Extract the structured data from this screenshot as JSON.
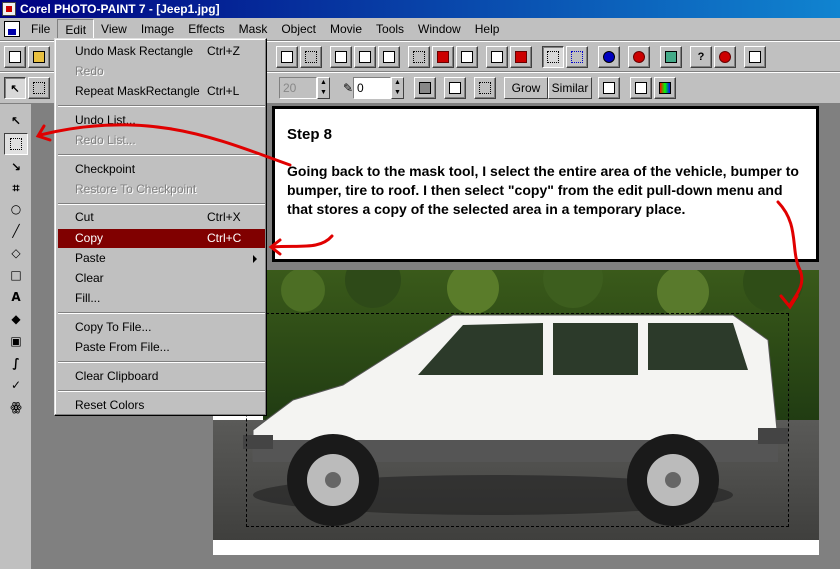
{
  "window": {
    "title": "Corel PHOTO-PAINT 7 - [Jeep1.jpg]"
  },
  "menubar": {
    "items": [
      "File",
      "Edit",
      "View",
      "Image",
      "Effects",
      "Mask",
      "Object",
      "Movie",
      "Tools",
      "Window",
      "Help"
    ],
    "active": "Edit"
  },
  "property_bar": {
    "size_value": "20",
    "transparency_value": "0",
    "grow_label": "Grow",
    "similar_label": "Similar"
  },
  "edit_menu": {
    "items": [
      {
        "label": "Undo Mask Rectangle",
        "shortcut": "Ctrl+Z",
        "disabled": false
      },
      {
        "label": "Redo",
        "shortcut": "",
        "disabled": true
      },
      {
        "label": "Repeat MaskRectangle",
        "shortcut": "Ctrl+L",
        "disabled": false
      },
      {
        "label": "Undo List...",
        "shortcut": "",
        "disabled": false
      },
      {
        "label": "Redo List...",
        "shortcut": "",
        "disabled": true
      },
      {
        "label": "Checkpoint",
        "shortcut": "",
        "disabled": false
      },
      {
        "label": "Restore To Checkpoint",
        "shortcut": "",
        "disabled": true
      },
      {
        "label": "Cut",
        "shortcut": "Ctrl+X",
        "disabled": false
      },
      {
        "label": "Copy",
        "shortcut": "Ctrl+C",
        "disabled": false,
        "highlighted": true
      },
      {
        "label": "Paste",
        "shortcut": "",
        "disabled": false,
        "submenu": true
      },
      {
        "label": "Clear",
        "shortcut": "",
        "disabled": false
      },
      {
        "label": "Fill...",
        "shortcut": "",
        "disabled": false
      },
      {
        "label": "Copy To File...",
        "shortcut": "",
        "disabled": false
      },
      {
        "label": "Paste From File...",
        "shortcut": "",
        "disabled": false
      },
      {
        "label": "Clear Clipboard",
        "shortcut": "",
        "disabled": false
      },
      {
        "label": "Reset Colors",
        "shortcut": "",
        "disabled": false
      }
    ]
  },
  "instruction": {
    "step": "Step 8",
    "text": "Going back to the mask tool, I select the entire area of the vehicle, bumper to bumper, tire to roof. I then select \"copy\" from the edit pull-down menu and that stores a copy of the selected area in a temporary place."
  },
  "colors": {
    "title_bar": "#000080",
    "menu_highlight": "#800000",
    "annotation_arrow": "#e00000",
    "chrome": "#c0c0c0"
  },
  "icons": [
    "new-icon",
    "open-icon",
    "mask-pointer-icon",
    "rectangle-mask-icon",
    "pick-tool-icon",
    "mask-tool-icon",
    "freehand-mask-icon",
    "crop-icon",
    "zoom-icon",
    "eyedropper-icon",
    "eraser-icon",
    "rectangle-shape-icon",
    "text-tool-icon",
    "fill-bucket-icon",
    "clone-icon",
    "paint-brush-icon",
    "effect-tool-icon",
    "image-sprayer-icon",
    "info-icon",
    "help-icon",
    "apple-icon"
  ]
}
